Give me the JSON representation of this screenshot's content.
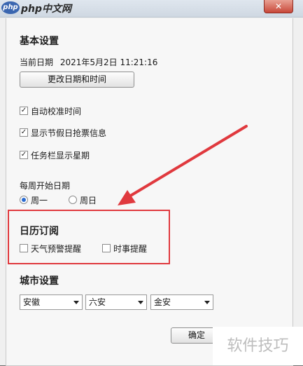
{
  "window": {
    "title": "php中文网",
    "close_label": "✕",
    "logo_label": "php"
  },
  "basic": {
    "title": "基本设置",
    "current_date_label": "当前日期",
    "current_date_value": "2021年5月2日 11:21:16",
    "change_button": "更改日期和时间",
    "checkboxes": [
      {
        "label": "自动校准时间",
        "checked": true
      },
      {
        "label": "显示节假日抢票信息",
        "checked": true
      },
      {
        "label": "任务栏显示星期",
        "checked": true
      }
    ]
  },
  "week_start": {
    "label": "每周开始日期",
    "options": [
      {
        "label": "周一",
        "selected": true
      },
      {
        "label": "周日",
        "selected": false
      }
    ]
  },
  "calendar_sub": {
    "title": "日历订阅",
    "options": [
      {
        "label": "天气预警提醒",
        "checked": false
      },
      {
        "label": "时事提醒",
        "checked": false
      }
    ]
  },
  "city": {
    "title": "城市设置",
    "province": "安徽",
    "city": "六安",
    "district": "金安"
  },
  "footer": {
    "ok_button": "确定"
  },
  "watermark": "软件技巧",
  "colors": {
    "highlight": "#e0393e",
    "radio_fill": "#2a6bd0"
  }
}
